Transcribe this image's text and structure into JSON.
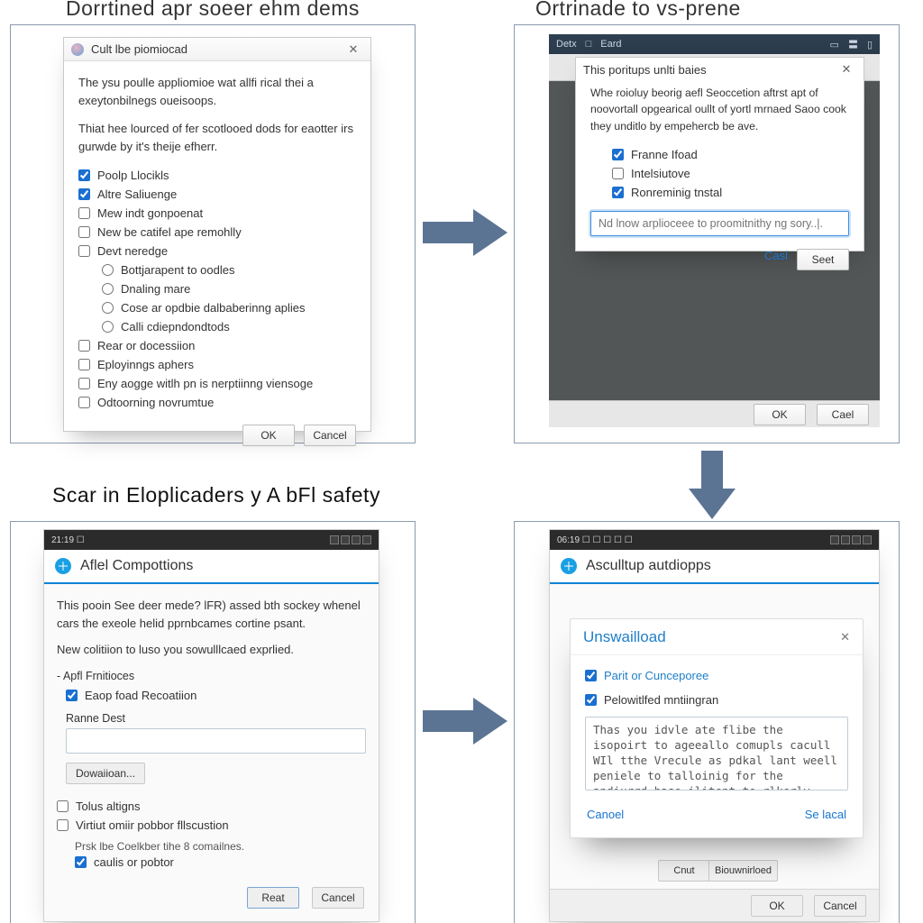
{
  "headings": {
    "tl": "Dorrtined apr soeer ehm dems",
    "tr": "Ortrinade to vs-prene",
    "bl": "Scar in Eloplicaders y A bFl safety"
  },
  "colors": {
    "accent": "#1a6fd1",
    "arrow": "#5b7494"
  },
  "step1": {
    "title": "Cult lbe piomiocad",
    "para1": "The ysu poulle appliomioe wat allfi rical thei a exeytonbilnegs oueisoops.",
    "para2": "Thiat hee lourced of fer scotlooed dods for eaotter irs gurwde by it's theije efherr.",
    "checks": [
      {
        "label": "Poolp Llocikls",
        "checked": true
      },
      {
        "label": "Altre Saliuenge",
        "checked": true
      },
      {
        "label": "Mew indt gonpoenat",
        "checked": false
      },
      {
        "label": "New be catifel ape remohlly",
        "checked": false
      },
      {
        "label": "Devt neredge",
        "checked": false
      }
    ],
    "radios": [
      "Bottjarapent to oodles",
      "Dnaling mare",
      "Cose ar opdbie dalbaberinng aplies",
      "Calli cdiepndondtods"
    ],
    "checks_after": [
      {
        "label": "Rear or docessiion",
        "checked": false
      },
      {
        "label": "Eployinngs aphers",
        "checked": false
      },
      {
        "label": "Eny aogge witlh pn is nerptiinng viensoge",
        "checked": false
      },
      {
        "label": "Odtoorning novrumtue",
        "checked": false
      }
    ],
    "ok": "OK",
    "cancel": "Cancel"
  },
  "step2": {
    "title": "This poritups unlti baies",
    "para": "Whe roioluy beorig aefl Seoccetion aftrst apt of noovortall opgearical oullt of yortl mrnaed Saoo cook they unditlo by empehercb be ave.",
    "checks": [
      {
        "label": "Franne Ifoad",
        "checked": true
      },
      {
        "label": "Intelsiutove",
        "checked": false
      },
      {
        "label": "Ronreminig tnstal",
        "checked": true
      }
    ],
    "input_placeholder": "Nd lnow arplioceee to proomitnithy ng sory..|.",
    "cancel": "Casl",
    "save": "Seet",
    "ok": "OK",
    "bottom_cancel": "Cael"
  },
  "step3": {
    "status_clock": "21:19 ☐",
    "header": "Aflel Compottions",
    "para1": "This pooin See deer mede? lFR) assed bth sockey whenel cars the exeole helid pprnbcames cortine psant.",
    "para2": "New colitiion to luso you sowulllcaed exprlied.",
    "group": "- Apfl Frnitioces",
    "check_eaop": {
      "label": "Eaop foad Recoatiion",
      "checked": true
    },
    "ranne_label": "Ranne Dest",
    "download": "Dowaiioan...",
    "checks_below": [
      {
        "label": "Tolus altigns",
        "checked": false
      },
      {
        "label": "Virtiut omiir pobbor fllscustion",
        "checked": false
      }
    ],
    "note": "Prsk lbe Coelkber tihe 8 comailnes.",
    "check_last": {
      "label": "caulis or pobtor",
      "checked": true
    },
    "reset": "Reat",
    "cancel": "Cancel"
  },
  "step4": {
    "status_clock": "06:19 ☐ ☐ ☐ ☐ ☐",
    "header": "Asculltup autdiopps",
    "popup_title": "Unswailload",
    "checks": [
      {
        "label": "Parit or Cunceporee",
        "checked": true
      },
      {
        "label": "Pelowitlfed mntiingran",
        "checked": true
      }
    ],
    "textarea": "Thas you idvle ate flibe the isopoirt to ageeallo comupls cacull WIl tthe Vrecule as pdkal lant weell peniele to talloinig for the andiurrd hase ilitent to rlkerly aptc snitlones..:'",
    "cancel": "Canoel",
    "select": "Se lacal",
    "ok": "OK",
    "bottom_cancel": "Cancel",
    "bottom_mid": "Cnut",
    "bottom_mid2": "Biouwnirloed"
  }
}
